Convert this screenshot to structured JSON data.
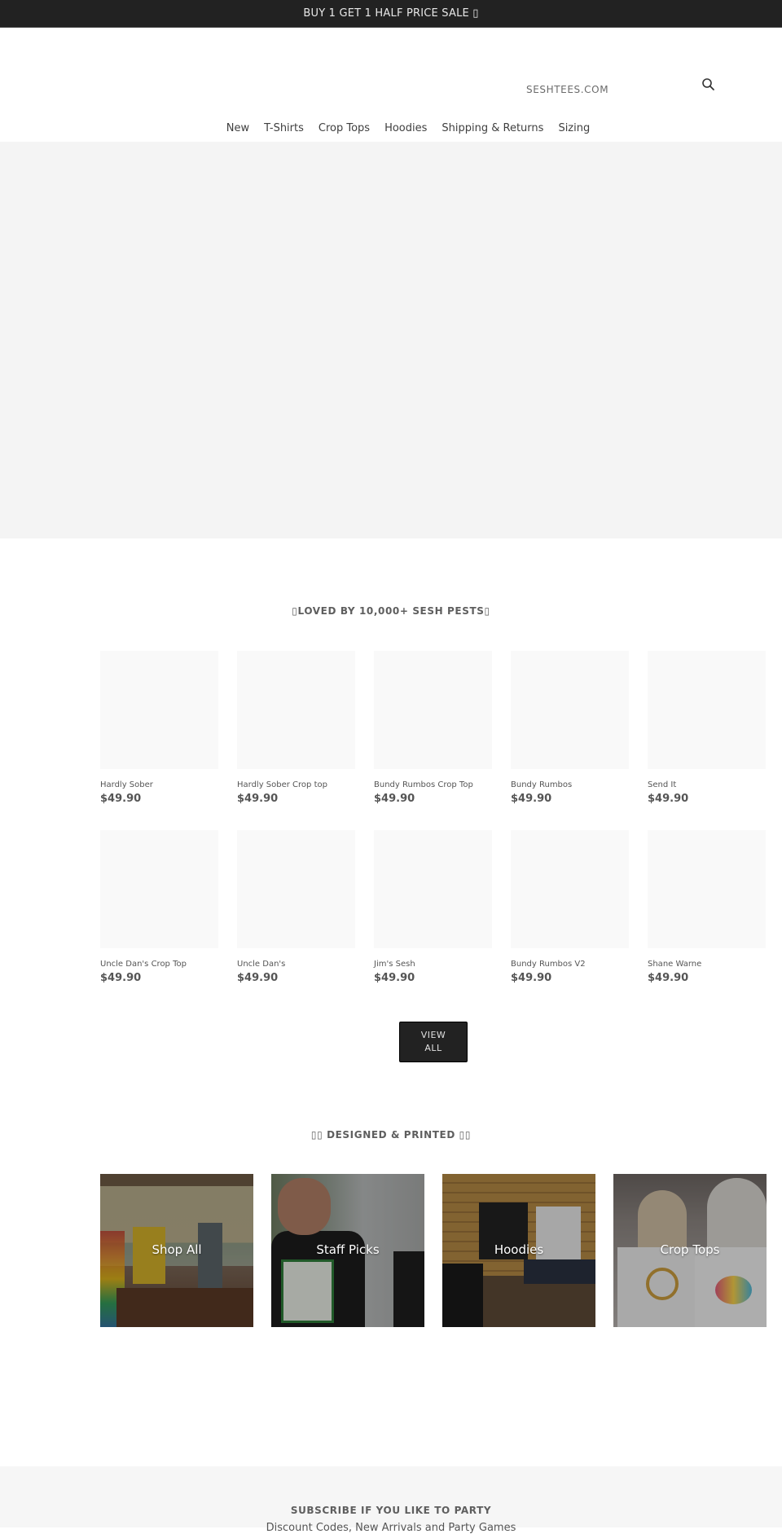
{
  "announcement": {
    "text": "BUY 1 GET 1 HALF PRICE SALE ▯"
  },
  "header": {
    "logo_text": "SESHTEES.COM",
    "search_icon": "search-icon",
    "nav": [
      {
        "label": "New"
      },
      {
        "label": "T-Shirts"
      },
      {
        "label": "Crop Tops"
      },
      {
        "label": "Hoodies"
      },
      {
        "label": "Shipping & Returns"
      },
      {
        "label": "Sizing"
      }
    ]
  },
  "featured": {
    "title": "▯LOVED BY 10,000+ SESH PESTS▯",
    "products": [
      {
        "title": "Hardly Sober",
        "price": "$49.90"
      },
      {
        "title": "Hardly Sober Crop top",
        "price": "$49.90"
      },
      {
        "title": "Bundy Rumbos Crop Top",
        "price": "$49.90"
      },
      {
        "title": "Bundy Rumbos",
        "price": "$49.90"
      },
      {
        "title": "Send It",
        "price": "$49.90"
      },
      {
        "title": "Uncle Dan's Crop Top",
        "price": "$49.90"
      },
      {
        "title": "Uncle Dan's",
        "price": "$49.90"
      },
      {
        "title": "Jim's Sesh",
        "price": "$49.90"
      },
      {
        "title": "Bundy Rumbos V2",
        "price": "$49.90"
      },
      {
        "title": "Shane Warne",
        "price": "$49.90"
      }
    ],
    "view_all": {
      "line1": "VIEW",
      "line2": "ALL"
    }
  },
  "collections": {
    "title": "▯▯ DESIGNED & PRINTED ▯▯",
    "items": [
      {
        "label": "Shop All"
      },
      {
        "label": "Staff Picks"
      },
      {
        "label": "Hoodies"
      },
      {
        "label": "Crop Tops"
      }
    ]
  },
  "newsletter": {
    "title": "SUBSCRIBE IF YOU LIKE TO PARTY",
    "subtitle": "Discount Codes, New Arrivals and Party Games"
  },
  "colors": {
    "announcement_bg": "#222222",
    "hero_bg": "#f4f4f4",
    "button_bg": "#222222",
    "newsletter_bg": "#f6f6f6"
  }
}
